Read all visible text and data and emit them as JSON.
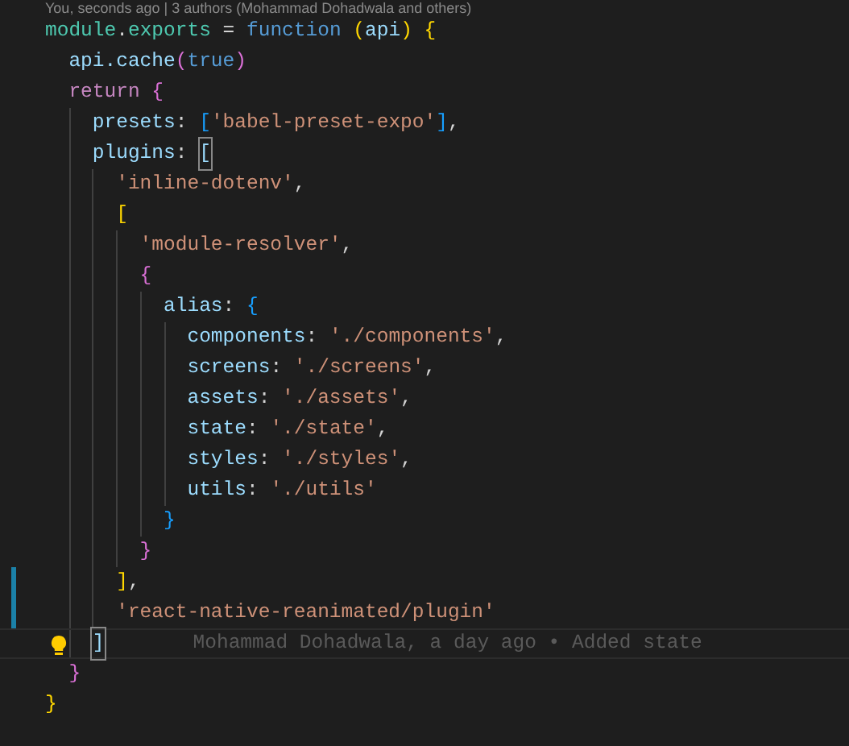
{
  "codelens": "You, seconds ago | 3 authors (Mohammad Dohadwala and others)",
  "lines": [
    {
      "kind": "plain",
      "tokens": [
        {
          "kind": "module",
          "text": "module"
        },
        {
          "kind": "punct",
          "text": "."
        },
        {
          "kind": "module",
          "text": "exports"
        },
        {
          "kind": "punct",
          "text": " = "
        },
        {
          "kind": "keyword",
          "text": "function "
        },
        {
          "kind": "gold",
          "text": "("
        },
        {
          "kind": "var",
          "text": "api"
        },
        {
          "kind": "gold",
          "text": ") "
        },
        {
          "kind": "gold",
          "text": "{"
        }
      ]
    },
    {
      "kind": "plain",
      "tokens": [
        {
          "kind": "var",
          "text": "  api.cache"
        },
        {
          "kind": "pink",
          "text": "("
        },
        {
          "kind": "keyword",
          "text": "true"
        },
        {
          "kind": "pink",
          "text": ")"
        }
      ]
    },
    {
      "kind": "plain",
      "tokens": [
        {
          "kind": "control",
          "text": "  return "
        },
        {
          "kind": "pink",
          "text": "{"
        }
      ]
    },
    {
      "kind": "plain",
      "tokens": [
        {
          "kind": "var",
          "text": "    presets"
        },
        {
          "kind": "punct",
          "text": ": "
        },
        {
          "kind": "blue",
          "text": "["
        },
        {
          "kind": "string",
          "text": "'babel-preset-expo'"
        },
        {
          "kind": "blue",
          "text": "]"
        },
        {
          "kind": "punct",
          "text": ","
        }
      ]
    },
    {
      "kind": "plain",
      "tokens": [
        {
          "kind": "var",
          "text": "    plugins"
        },
        {
          "kind": "punct",
          "text": ": "
        },
        {
          "kind": "matched",
          "text": "["
        }
      ]
    },
    {
      "kind": "plain",
      "tokens": [
        {
          "kind": "string",
          "text": "      'inline-dotenv'"
        },
        {
          "kind": "punct",
          "text": ","
        }
      ]
    },
    {
      "kind": "plain",
      "tokens": [
        {
          "kind": "gold",
          "text": "      ["
        }
      ]
    },
    {
      "kind": "plain",
      "tokens": [
        {
          "kind": "string",
          "text": "        'module-resolver'"
        },
        {
          "kind": "punct",
          "text": ","
        }
      ]
    },
    {
      "kind": "plain",
      "tokens": [
        {
          "kind": "pink",
          "text": "        {"
        }
      ]
    },
    {
      "kind": "plain",
      "tokens": [
        {
          "kind": "var",
          "text": "          alias"
        },
        {
          "kind": "punct",
          "text": ": "
        },
        {
          "kind": "blue",
          "text": "{"
        }
      ]
    },
    {
      "kind": "plain",
      "tokens": [
        {
          "kind": "var",
          "text": "            components"
        },
        {
          "kind": "punct",
          "text": ": "
        },
        {
          "kind": "string",
          "text": "'./components'"
        },
        {
          "kind": "punct",
          "text": ","
        }
      ]
    },
    {
      "kind": "plain",
      "tokens": [
        {
          "kind": "var",
          "text": "            screens"
        },
        {
          "kind": "punct",
          "text": ": "
        },
        {
          "kind": "string",
          "text": "'./screens'"
        },
        {
          "kind": "punct",
          "text": ","
        }
      ]
    },
    {
      "kind": "plain",
      "tokens": [
        {
          "kind": "var",
          "text": "            assets"
        },
        {
          "kind": "punct",
          "text": ": "
        },
        {
          "kind": "string",
          "text": "'./assets'"
        },
        {
          "kind": "punct",
          "text": ","
        }
      ]
    },
    {
      "kind": "plain",
      "tokens": [
        {
          "kind": "var",
          "text": "            state"
        },
        {
          "kind": "punct",
          "text": ": "
        },
        {
          "kind": "string",
          "text": "'./state'"
        },
        {
          "kind": "punct",
          "text": ","
        }
      ]
    },
    {
      "kind": "plain",
      "tokens": [
        {
          "kind": "var",
          "text": "            styles"
        },
        {
          "kind": "punct",
          "text": ": "
        },
        {
          "kind": "string",
          "text": "'./styles'"
        },
        {
          "kind": "punct",
          "text": ","
        }
      ]
    },
    {
      "kind": "plain",
      "tokens": [
        {
          "kind": "var",
          "text": "            utils"
        },
        {
          "kind": "punct",
          "text": ": "
        },
        {
          "kind": "string",
          "text": "'./utils'"
        }
      ]
    },
    {
      "kind": "plain",
      "tokens": [
        {
          "kind": "blue",
          "text": "          }"
        }
      ]
    },
    {
      "kind": "plain",
      "tokens": [
        {
          "kind": "pink",
          "text": "        }"
        }
      ]
    },
    {
      "kind": "modified",
      "tokens": [
        {
          "kind": "gold",
          "text": "      ]"
        },
        {
          "kind": "punct",
          "text": ","
        }
      ]
    },
    {
      "kind": "modified",
      "tokens": [
        {
          "kind": "string",
          "text": "      'react-native-reanimated/plugin'"
        }
      ]
    },
    {
      "kind": "current",
      "blame": "Mohammad Dohadwala, a day ago • Added state",
      "tokens": [
        {
          "kind": "matched",
          "text": "    ]"
        }
      ]
    },
    {
      "kind": "plain",
      "tokens": [
        {
          "kind": "pink",
          "text": "  }"
        }
      ]
    },
    {
      "kind": "plain",
      "tokens": [
        {
          "kind": "gold",
          "text": "}"
        }
      ]
    }
  ]
}
